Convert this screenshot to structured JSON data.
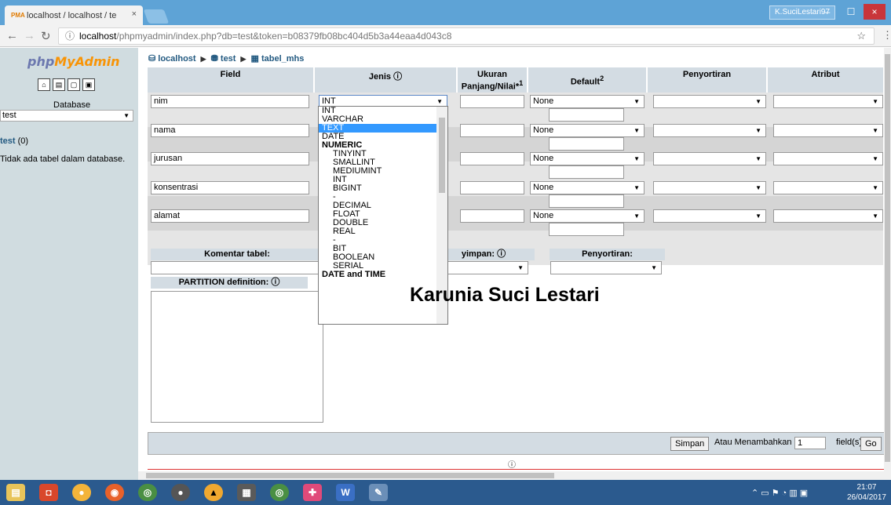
{
  "browser": {
    "tab_title": "localhost / localhost / te",
    "tab_close": "×",
    "user_badge": "K.SuciLestari97",
    "minimize": "–",
    "maximize": "☐",
    "close": "×",
    "url_host": "localhost",
    "url_path": "/phpmyadmin/index.php?db=test&token=b08379fb08bc404d5b3a44eaa4d043c8"
  },
  "sidebar": {
    "logo_a": "php",
    "logo_b": "MyAdmin",
    "db_label": "Database",
    "db_selected": "test",
    "db_link": "test",
    "db_count": "(0)",
    "no_tables": "Tidak ada tabel dalam database."
  },
  "breadcrumb": {
    "server": "localhost",
    "db": "test",
    "table": "tabel_mhs"
  },
  "table_headers": {
    "field": "Field",
    "jenis": "Jenis",
    "ukuran_1": "Ukuran",
    "ukuran_2": "Panjang/Nilai*",
    "ukuran_sup": "1",
    "default": "Default",
    "default_sup": "2",
    "penyortiran": "Penyortiran",
    "atribut": "Atribut"
  },
  "rows": [
    {
      "field": "nim",
      "jenis": "INT",
      "default": "None"
    },
    {
      "field": "nama",
      "jenis": "",
      "default": "None"
    },
    {
      "field": "jurusan",
      "jenis": "",
      "default": "None"
    },
    {
      "field": "konsentrasi",
      "jenis": "",
      "default": "None"
    },
    {
      "field": "alamat",
      "jenis": "",
      "default": "None"
    }
  ],
  "sections": {
    "komentar": "Komentar tabel:",
    "penyimpan": "yimpan:",
    "penyortiran": "Penyortiran:",
    "partition": "PARTITION definition:"
  },
  "dropdown": {
    "items": [
      {
        "label": "INT",
        "kind": "plain"
      },
      {
        "label": "VARCHAR",
        "kind": "plain"
      },
      {
        "label": "TEXT",
        "kind": "selected"
      },
      {
        "label": "DATE",
        "kind": "plain"
      },
      {
        "label": "NUMERIC",
        "kind": "group"
      },
      {
        "label": "TINYINT",
        "kind": "indent"
      },
      {
        "label": "SMALLINT",
        "kind": "indent"
      },
      {
        "label": "MEDIUMINT",
        "kind": "indent"
      },
      {
        "label": "INT",
        "kind": "indent"
      },
      {
        "label": "BIGINT",
        "kind": "indent"
      },
      {
        "label": "-",
        "kind": "indent"
      },
      {
        "label": "DECIMAL",
        "kind": "indent"
      },
      {
        "label": "FLOAT",
        "kind": "indent"
      },
      {
        "label": "DOUBLE",
        "kind": "indent"
      },
      {
        "label": "REAL",
        "kind": "indent"
      },
      {
        "label": "-",
        "kind": "indent"
      },
      {
        "label": "BIT",
        "kind": "indent"
      },
      {
        "label": "BOOLEAN",
        "kind": "indent"
      },
      {
        "label": "SERIAL",
        "kind": "indent"
      },
      {
        "label": "DATE and TIME",
        "kind": "group"
      }
    ]
  },
  "watermark": "Karunia Suci Lestari",
  "footer": {
    "save": "Simpan",
    "add_text": "Atau Menambahkan",
    "add_value": "1",
    "fields_text": "field(s)",
    "go": "Go"
  },
  "taskbar": {
    "time": "21:07",
    "date": "26/04/2017"
  }
}
